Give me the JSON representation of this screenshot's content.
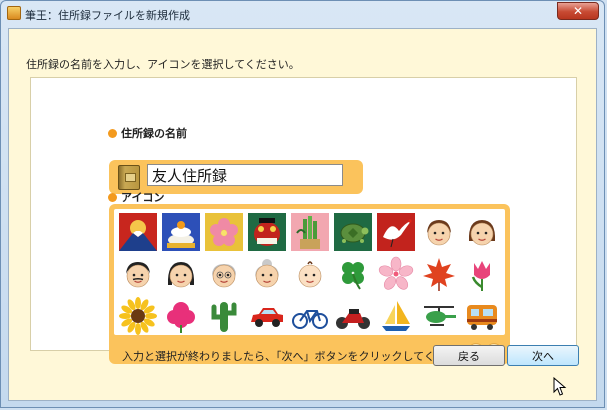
{
  "window": {
    "title": "筆王：住所録ファイルを新規作成",
    "close_label": "✕"
  },
  "instruction": "住所録の名前を入力し、アイコンを選択してください。",
  "name_section": {
    "label": "住所録の名前",
    "value": "友人住所録"
  },
  "icon_section": {
    "label": "アイコン",
    "icons": [
      [
        "fuji-sunrise-icon",
        "kagami-mochi-icon",
        "plum-blossom-icon",
        "shishimai-icon",
        "kadomatsu-icon",
        "turtle-icon",
        "crane-icon",
        "boy-face-icon",
        "girl-face-icon"
      ],
      [
        "man-face-icon",
        "woman-face-icon",
        "grandpa-face-icon",
        "grandma-face-icon",
        "baby-face-icon",
        "four-leaf-clover-icon",
        "sakura-icon",
        "maple-leaf-icon",
        "tulip-icon"
      ],
      [
        "sunflower-icon",
        "carnation-icon",
        "cactus-icon",
        "car-icon",
        "bicycle-icon",
        "motorcycle-icon",
        "sailboat-icon",
        "helicopter-icon",
        "train-icon"
      ]
    ]
  },
  "footer": {
    "hint": "入力と選択が終わりましたら、「次へ」ボタンをクリックしてください。",
    "back_label": "戻る",
    "next_label": "次へ"
  },
  "colors": {
    "panel_orange": "#fbc35c",
    "bullet": "#f39a1e",
    "client_bg": "#fff8d8"
  }
}
